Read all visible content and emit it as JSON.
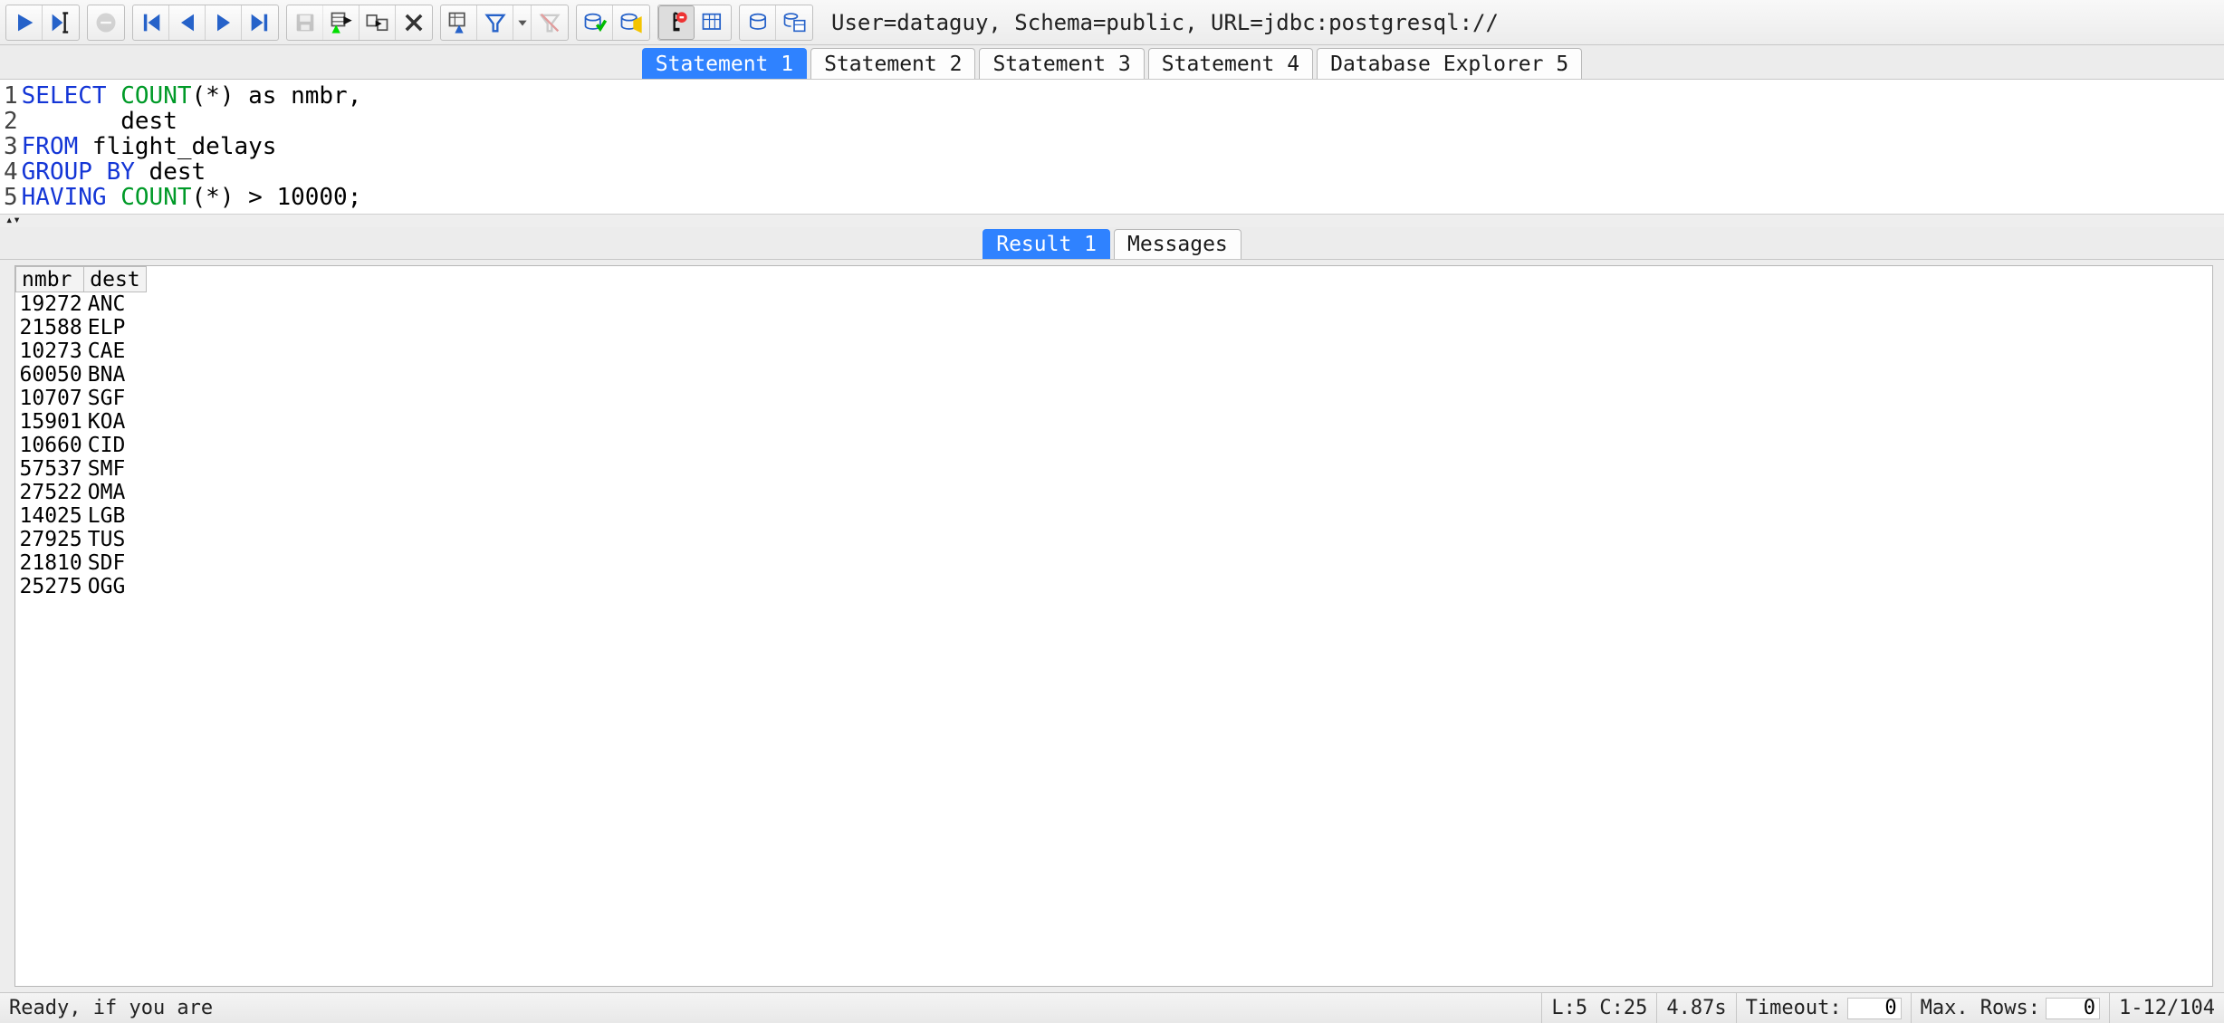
{
  "connection_info": "User=dataguy, Schema=public, URL=jdbc:postgresql://",
  "toolbar": {
    "run": "run",
    "run_cursor": "run-at-cursor",
    "stop": "stop",
    "first": "first-record",
    "prev": "prev-record",
    "next": "next-record",
    "last": "last-record",
    "save": "save",
    "insert_row": "insert-row",
    "copy_row": "copy-row",
    "delete_row": "delete-row",
    "select_cols": "select-columns",
    "filter": "filter",
    "filter_dd": "filter-dropdown",
    "clear_filter": "clear-filter",
    "commit": "commit",
    "exec_script": "execute-script",
    "stop_exec": "stop-execution",
    "show_obj": "show-db-objects",
    "db_disconnect": "db-disconnect",
    "db_info": "db-info"
  },
  "tabs": [
    {
      "label": "Statement 1",
      "active": true
    },
    {
      "label": "Statement 2",
      "active": false
    },
    {
      "label": "Statement 3",
      "active": false
    },
    {
      "label": "Statement 4",
      "active": false
    },
    {
      "label": "Database Explorer 5",
      "active": false
    }
  ],
  "sql_lines": [
    {
      "n": "1",
      "html": "<span class='kw'>SELECT</span> <span class='fn'>COUNT</span>(<span class='op'>*</span>) as nmbr,"
    },
    {
      "n": "2",
      "html": "       dest"
    },
    {
      "n": "3",
      "html": "<span class='kw'>FROM</span> flight_delays"
    },
    {
      "n": "4",
      "html": "<span class='kw'>GROUP BY</span> dest"
    },
    {
      "n": "5",
      "html": "<span class='kw'>HAVING</span> <span class='fn'>COUNT</span>(<span class='op'>*</span>) &gt; 10000;"
    }
  ],
  "result_tabs": [
    {
      "label": "Result 1",
      "active": true
    },
    {
      "label": "Messages",
      "active": false
    }
  ],
  "columns": [
    "nmbr",
    "dest"
  ],
  "rows": [
    {
      "nmbr": "19272",
      "dest": "ANC"
    },
    {
      "nmbr": "21588",
      "dest": "ELP"
    },
    {
      "nmbr": "10273",
      "dest": "CAE"
    },
    {
      "nmbr": "60050",
      "dest": "BNA"
    },
    {
      "nmbr": "10707",
      "dest": "SGF"
    },
    {
      "nmbr": "15901",
      "dest": "KOA"
    },
    {
      "nmbr": "10660",
      "dest": "CID"
    },
    {
      "nmbr": "57537",
      "dest": "SMF"
    },
    {
      "nmbr": "27522",
      "dest": "OMA"
    },
    {
      "nmbr": "14025",
      "dest": "LGB"
    },
    {
      "nmbr": "27925",
      "dest": "TUS"
    },
    {
      "nmbr": "21810",
      "dest": "SDF"
    },
    {
      "nmbr": "25275",
      "dest": "OGG"
    }
  ],
  "status": {
    "message": "Ready, if you are",
    "cursor": "L:5 C:25",
    "elapsed": "4.87s",
    "timeout_label": "Timeout:",
    "timeout_value": "0",
    "maxrows_label": "Max. Rows:",
    "maxrows_value": "0",
    "row_range": "1-12/104"
  }
}
